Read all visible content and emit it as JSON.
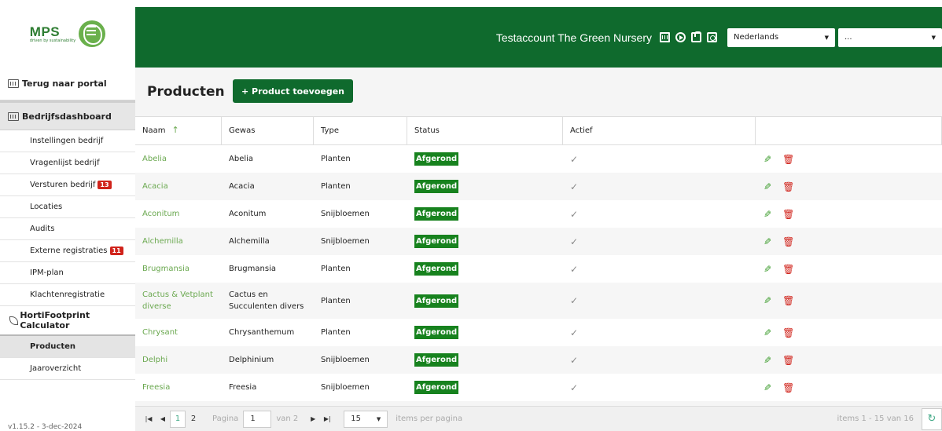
{
  "logo": {
    "name": "MPS",
    "tagline": "driven by sustainability"
  },
  "header": {
    "account": "Testaccount The Green Nursery",
    "language": "Nederlands",
    "account_select": "..."
  },
  "sidebar": {
    "portal": "Terug naar portal",
    "dashboard": "Bedrijfsdashboard",
    "dashboard_items": [
      {
        "label": "Instellingen bedrijf"
      },
      {
        "label": "Vragenlijst bedrijf"
      },
      {
        "label": "Versturen bedrijf",
        "badge": "13"
      },
      {
        "label": "Locaties"
      },
      {
        "label": "Audits"
      },
      {
        "label": "Externe registraties",
        "badge": "11"
      },
      {
        "label": "IPM-plan"
      },
      {
        "label": "Klachtenregistratie"
      }
    ],
    "calculator": "HortiFootprint Calculator",
    "calculator_items": [
      {
        "label": "Producten"
      },
      {
        "label": "Jaaroverzicht"
      }
    ],
    "version": "v1.15.2 - 3-dec-2024"
  },
  "main": {
    "title": "Producten",
    "add_button": "+ Product toevoegen",
    "columns": [
      "Naam",
      "Gewas",
      "Type",
      "Status",
      "Actief"
    ],
    "sort_arrow": "↑",
    "rows": [
      {
        "naam": "Abelia",
        "gewas": "Abelia",
        "type": "Planten",
        "status": "Afgerond",
        "actief": "✓"
      },
      {
        "naam": "Acacia",
        "gewas": "Acacia",
        "type": "Planten",
        "status": "Afgerond",
        "actief": "✓"
      },
      {
        "naam": "Aconitum",
        "gewas": "Aconitum",
        "type": "Snijbloemen",
        "status": "Afgerond",
        "actief": "✓"
      },
      {
        "naam": "Alchemilla",
        "gewas": "Alchemilla",
        "type": "Snijbloemen",
        "status": "Afgerond",
        "actief": "✓"
      },
      {
        "naam": "Brugmansia",
        "gewas": "Brugmansia",
        "type": "Planten",
        "status": "Afgerond",
        "actief": "✓"
      },
      {
        "naam": "Cactus & Vetplant diverse",
        "gewas": "Cactus en Succulenten divers",
        "type": "Planten",
        "status": "Afgerond",
        "actief": "✓"
      },
      {
        "naam": "Chrysant",
        "gewas": "Chrysanthemum",
        "type": "Planten",
        "status": "Afgerond",
        "actief": "✓"
      },
      {
        "naam": "Delphi",
        "gewas": "Delphinium",
        "type": "Snijbloemen",
        "status": "Afgerond",
        "actief": "✓"
      },
      {
        "naam": "Freesia",
        "gewas": "Freesia",
        "type": "Snijbloemen",
        "status": "Afgerond",
        "actief": "✓"
      }
    ]
  },
  "pager": {
    "pages": [
      "1",
      "2"
    ],
    "page_label": "Pagina",
    "current_page": "1",
    "of_label": "van 2",
    "page_size": "15",
    "per_page_label": "items per pagina",
    "info": "items 1 - 15 van 16"
  },
  "colors": {
    "brand_green": "#0f6a2d",
    "status_green": "#17821e",
    "badge_red": "#d0231b",
    "link_green": "#6aa84f"
  }
}
